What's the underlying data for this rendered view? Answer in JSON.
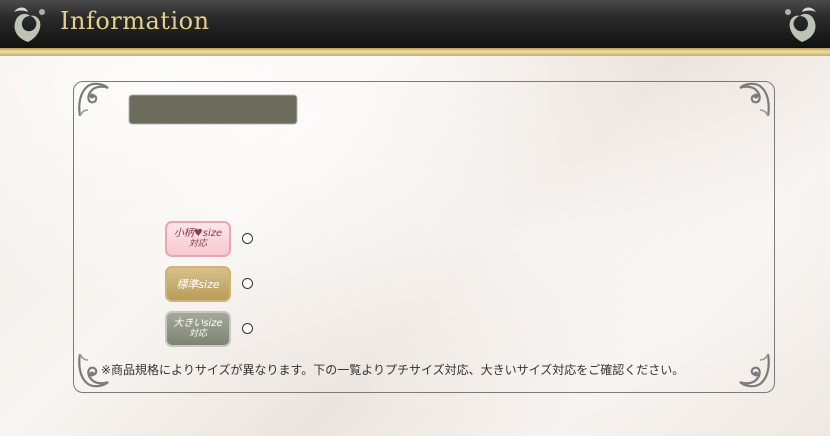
{
  "header": {
    "title": "Information",
    "left_ornament_icon": "floral-ornament-icon",
    "right_ornament_icon": "floral-ornament-icon",
    "colors": {
      "title": "#e6cf8a",
      "bar": "#1a1a1a",
      "rule": "#d8c07a"
    }
  },
  "panel": {
    "corner_icon": "scroll-corner-icon",
    "sizes": [
      {
        "line1": "小柄♥size",
        "line2": "対応",
        "color": "#f7c8d0"
      },
      {
        "line1": "標準size",
        "line2": "",
        "color": "#c8ad6c"
      },
      {
        "line1": "大きいsize",
        "line2": "対応",
        "color": "#8f9584"
      }
    ],
    "note": "※商品規格によりサイズが異なります。下の一覧よりプチサイズ対応、大きいサイズ対応をご確認ください。"
  }
}
